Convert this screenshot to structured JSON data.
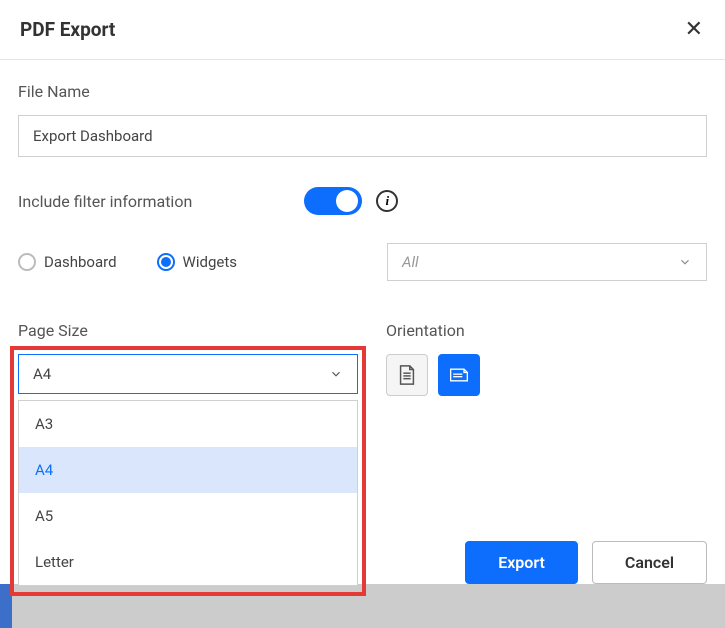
{
  "header": {
    "title": "PDF Export"
  },
  "fileName": {
    "label": "File Name",
    "value": "Export Dashboard"
  },
  "filter": {
    "label": "Include filter information",
    "enabled": true
  },
  "scope": {
    "options": [
      {
        "label": "Dashboard",
        "selected": false
      },
      {
        "label": "Widgets",
        "selected": true
      }
    ],
    "widgetSelect": {
      "value": "All"
    }
  },
  "pageSize": {
    "label": "Page Size",
    "value": "A4",
    "options": [
      "A3",
      "A4",
      "A5",
      "Letter"
    ]
  },
  "orientation": {
    "label": "Orientation",
    "selected": "landscape"
  },
  "footer": {
    "export": "Export",
    "cancel": "Cancel"
  }
}
